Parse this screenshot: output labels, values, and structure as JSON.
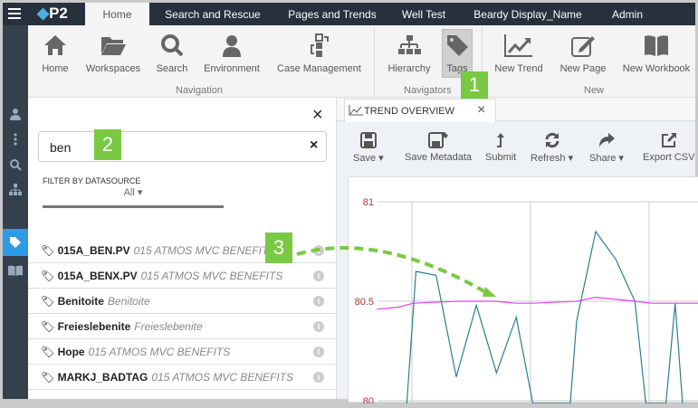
{
  "topbar": {
    "tabs": [
      "Home",
      "Search and Rescue",
      "Pages and Trends",
      "Well Test",
      "Beardy Display_Name",
      "Admin"
    ],
    "logo": "P2"
  },
  "ribbon": {
    "navigation": {
      "label": "Navigation",
      "buttons": [
        "Home",
        "Workspaces",
        "Search",
        "Environment",
        "Case Management"
      ]
    },
    "navigators": {
      "label": "Navigators",
      "buttons": [
        "Hierarchy",
        "Tags"
      ]
    },
    "new": {
      "label": "New",
      "buttons": [
        "New Trend",
        "New Page",
        "New Workbook"
      ]
    }
  },
  "panel": {
    "close": "×",
    "search_value": "ben",
    "clear": "×",
    "filter_label": "FILTER BY DATASOURCE",
    "filter_value": "All",
    "results": [
      {
        "name": "015A_BEN.PV",
        "source": "015 ATMOS MVC BENEFITS"
      },
      {
        "name": "015A_BENX.PV",
        "source": "015 ATMOS MVC BENEFITS"
      },
      {
        "name": "Benitoite",
        "source": "Benitoite"
      },
      {
        "name": "Freieslebenite",
        "source": "Freieslebenite"
      },
      {
        "name": "Hope",
        "source": "015 ATMOS MVC BENEFITS"
      },
      {
        "name": "MARKJ_BADTAG",
        "source": "015 ATMOS MVC BENEFITS"
      }
    ]
  },
  "trend": {
    "tab_title": "TREND OVERVIEW",
    "close": "×",
    "toolbar": [
      "Save",
      "Save Metadata",
      "Submit",
      "Refresh",
      "Share",
      "Export CSV"
    ]
  },
  "callouts": [
    "1",
    "2",
    "3"
  ],
  "colors": {
    "accent": "#7ac943",
    "nav": "#27313e",
    "teal": "#2a7f8f",
    "magenta": "#e040fb",
    "axis_label": "#a33"
  },
  "chart_data": {
    "type": "line",
    "ylim": [
      80,
      81
    ],
    "xlim": [
      0,
      100
    ],
    "yticks": [
      "81",
      "80.5",
      "80"
    ],
    "grid": true,
    "series": [
      {
        "name": "teal",
        "points": [
          [
            16.5,
            79.9
          ],
          [
            19.1,
            80.65
          ],
          [
            24.8,
            80.63
          ],
          [
            30.5,
            80.12
          ],
          [
            36.2,
            80.48
          ],
          [
            41.9,
            80.14
          ],
          [
            47.5,
            80.42
          ],
          [
            52.2,
            79.9
          ],
          [
            62.8,
            79.9
          ],
          [
            64.6,
            80.4
          ],
          [
            70,
            80.85
          ],
          [
            75.7,
            80.71
          ],
          [
            81.1,
            80.5
          ],
          [
            84.2,
            79.9
          ],
          [
            89.9,
            79.9
          ],
          [
            92.5,
            80.49
          ],
          [
            94.6,
            79.9
          ]
        ]
      },
      {
        "name": "magenta",
        "points": [
          [
            8,
            80.46
          ],
          [
            14,
            80.47
          ],
          [
            18.3,
            80.49
          ],
          [
            30.5,
            80.5
          ],
          [
            41.6,
            80.5
          ],
          [
            47.5,
            80.49
          ],
          [
            52.2,
            80.49
          ],
          [
            64.6,
            80.5
          ],
          [
            70,
            80.52
          ],
          [
            81.1,
            80.5
          ],
          [
            86,
            80.49
          ],
          [
            100,
            80.49
          ]
        ]
      }
    ]
  }
}
